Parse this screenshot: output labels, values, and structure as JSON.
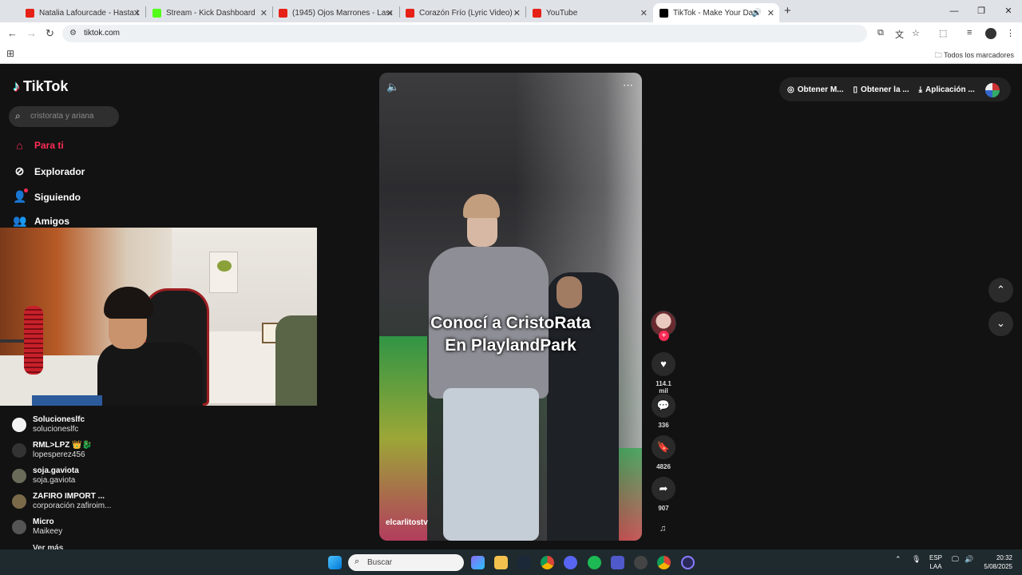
{
  "browser": {
    "tabs": [
      {
        "title": "Natalia Lafourcade - Hasta La R",
        "favicon_color": "#e62117"
      },
      {
        "title": "Stream - Kick Dashboard",
        "favicon_color": "#53fc18"
      },
      {
        "title": "(1945) Ojos Marrones - Lasso (L",
        "favicon_color": "#e62117"
      },
      {
        "title": "Corazón Frío (Lyric Video) - Jas",
        "favicon_color": "#e62117"
      },
      {
        "title": "YouTube",
        "favicon_color": "#e62117"
      },
      {
        "title": "TikTok - Make Your Day",
        "favicon_color": "#000000",
        "active": true
      }
    ],
    "url": "tiktok.com",
    "all_bookmarks_label": "Todos los marcadores"
  },
  "tiktok": {
    "logo_text": "TikTok",
    "search_placeholder": "cristorata y ariana",
    "nav": [
      {
        "label": "Para ti",
        "icon": "home-icon",
        "active": true
      },
      {
        "label": "Explorador",
        "icon": "compass-icon"
      },
      {
        "label": "Siguiendo",
        "icon": "following-icon"
      },
      {
        "label": "Amigos",
        "icon": "friends-icon"
      }
    ],
    "following_accounts": [
      {
        "name": "Solucioneslfc",
        "handle": "solucioneslfc",
        "avatar_color": "#f2f2f2"
      },
      {
        "name": "RML>LPZ 👑🐉",
        "handle": "lopesperez456",
        "avatar_color": "#333333"
      },
      {
        "name": "soja.gaviota",
        "handle": "soja.gaviota",
        "avatar_color": "#6b6b5a"
      },
      {
        "name": "ZAFIRO IMPORT ...",
        "handle": "corporación zafiroim...",
        "avatar_color": "#7a6a4a"
      },
      {
        "name": "Micro",
        "handle": "Maikeey",
        "avatar_color": "#555555"
      }
    ],
    "more_label": "Ver más",
    "video": {
      "caption_line1": "Conocí a CristoRata",
      "caption_line2": "En PlaylandPark",
      "author_handle": "elcarlitostv"
    },
    "actions": {
      "likes": "114.1 mil",
      "comments": "336",
      "saves": "4826",
      "shares": "907"
    },
    "topbar": {
      "item1": "Obtener M...",
      "item2": "Obtener la ...",
      "item3": "Aplicación ..."
    }
  },
  "taskbar": {
    "search_placeholder": "Buscar",
    "lang_line1": "ESP",
    "lang_line2": "LAA",
    "time": "20:32",
    "date": "5/08/2025"
  }
}
